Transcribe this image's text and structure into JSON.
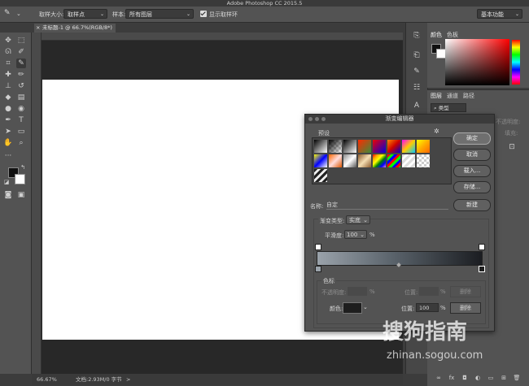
{
  "app_title": "Adobe Photoshop CC 2015.5",
  "options_bar": {
    "sample_size_label": "取样大小:",
    "sample_size_value": "取样点",
    "sample_label": "样本:",
    "sample_value": "所有图层",
    "show_ring_label": "显示取样环",
    "workspace_value": "基本功能"
  },
  "document_tab": {
    "title": "未标题-1 @ 66.7%(RGB/8*)"
  },
  "status_bar": {
    "zoom": "66.67%",
    "doc_info": "文档:2.93M/0 字节"
  },
  "color_panel": {
    "tabs": [
      "颜色",
      "色板"
    ]
  },
  "layers_panel": {
    "tabs": [
      "图层",
      "通道",
      "路径"
    ],
    "kind_label": "类型",
    "opacity_label": "不透明度:",
    "fill_label": "填充:"
  },
  "gradient_editor": {
    "title": "渐变编辑器",
    "presets_label": "预设",
    "buttons": {
      "ok": "确定",
      "cancel": "取消",
      "load": "载入...",
      "save": "存储...",
      "new": "新建"
    },
    "name_label": "名称:",
    "name_value": "自定",
    "gradient_type_label": "渐变类型:",
    "gradient_type_value": "实底",
    "smoothness_label": "平滑度:",
    "smoothness_value": "100",
    "smoothness_unit": "%",
    "stops_label": "色标",
    "opacity_label": "不透明度:",
    "opacity_unit": "%",
    "location_label": "位置:",
    "location_unit": "%",
    "delete_label": "删除",
    "color_label": "颜色:",
    "location_value": "100",
    "color_swatch": "#1e1e1e"
  },
  "watermark": {
    "brand": "搜狗指南",
    "url": "zhinan.sogou.com"
  }
}
